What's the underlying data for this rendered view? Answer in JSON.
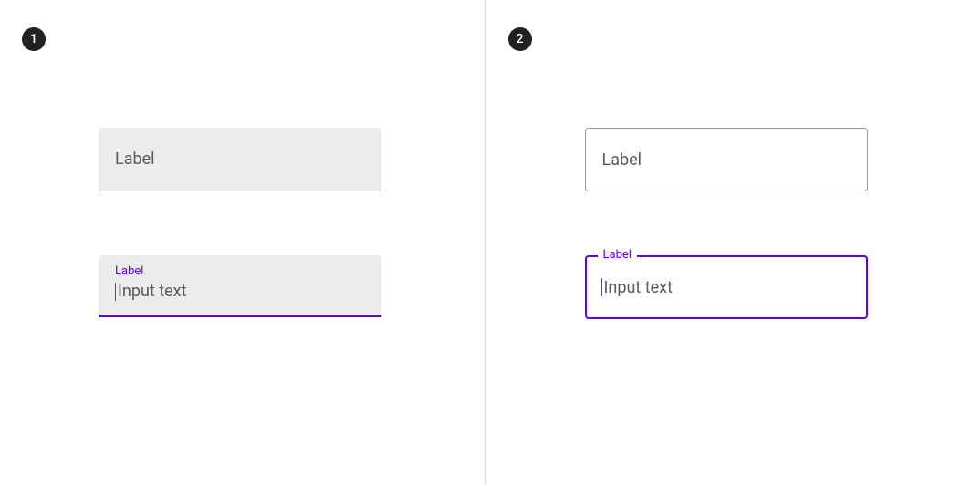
{
  "panels": {
    "left": {
      "badge": "1",
      "filled_inactive": {
        "label": "Label"
      },
      "filled_focused": {
        "label": "Label",
        "input_text": "Input text"
      }
    },
    "right": {
      "badge": "2",
      "outlined_inactive": {
        "label": "Label"
      },
      "outlined_focused": {
        "label": "Label",
        "input_text": "Input text"
      }
    }
  },
  "colors": {
    "primary": "#6200ee",
    "surface_variant": "#ececec",
    "outline": "#9a9a9a",
    "on_surface": "#5a5a5a",
    "badge_bg": "#212121"
  }
}
